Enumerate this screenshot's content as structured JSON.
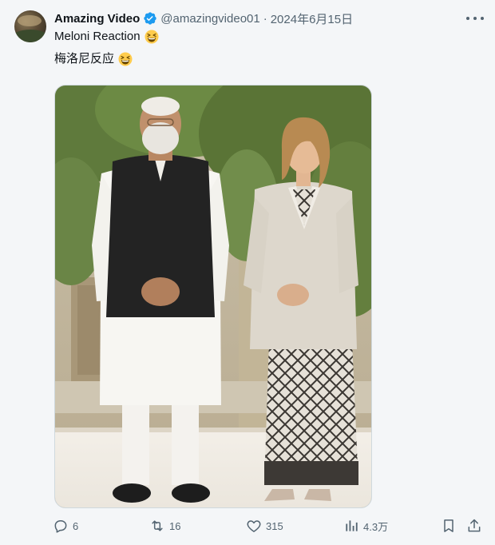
{
  "author": {
    "display_name": "Amazing Video",
    "handle": "@amazingvideo01",
    "separator": "·",
    "date": "2024年6月15日",
    "verified": true,
    "badge_color": "#1d9bf0"
  },
  "tweet": {
    "line1": "Meloni Reaction",
    "line2": "梅洛尼反应",
    "emoji": "grinning-squinting-face"
  },
  "actions": {
    "replies": "6",
    "retweets": "16",
    "likes": "315",
    "views": "4.3万"
  },
  "colors": {
    "text": "#0f1419",
    "secondary": "#536471",
    "background": "#f4f6f8",
    "border": "#cfd9de"
  }
}
